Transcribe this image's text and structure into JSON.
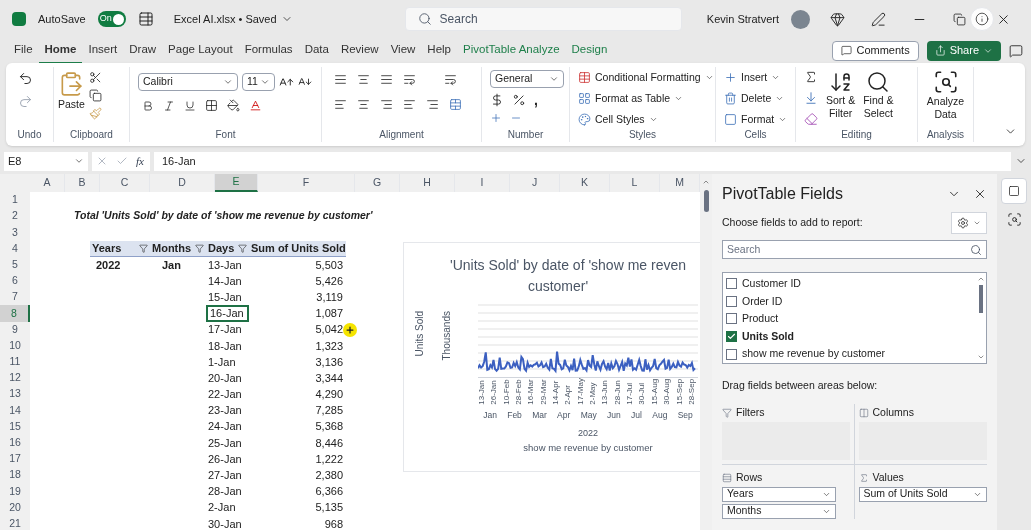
{
  "title_bar": {
    "autosave_label": "AutoSave",
    "autosave_on": true,
    "autosave_state": "On",
    "file_name": "Excel AI.xlsx • Saved",
    "search_placeholder": "Search",
    "user_name": "Kevin Stratvert"
  },
  "ribbon_tabs": [
    {
      "label": "File",
      "selected": false,
      "kind": "plain"
    },
    {
      "label": "Home",
      "selected": true,
      "kind": "plain"
    },
    {
      "label": "Insert",
      "selected": false,
      "kind": "plain"
    },
    {
      "label": "Draw",
      "selected": false,
      "kind": "plain"
    },
    {
      "label": "Page Layout",
      "selected": false,
      "kind": "plain"
    },
    {
      "label": "Formulas",
      "selected": false,
      "kind": "plain"
    },
    {
      "label": "Data",
      "selected": false,
      "kind": "plain"
    },
    {
      "label": "Review",
      "selected": false,
      "kind": "plain"
    },
    {
      "label": "View",
      "selected": false,
      "kind": "plain"
    },
    {
      "label": "Help",
      "selected": false,
      "kind": "plain"
    },
    {
      "label": "PivotTable Analyze",
      "selected": false,
      "kind": "contextual"
    },
    {
      "label": "Design",
      "selected": false,
      "kind": "contextual"
    }
  ],
  "comments_button": "Comments",
  "share_button": "Share",
  "ribbon": {
    "undo": {
      "label": "Undo"
    },
    "clipboard": {
      "label": "Clipboard",
      "paste": "Paste"
    },
    "font": {
      "label": "Font",
      "name": "Calibri",
      "size": "11"
    },
    "alignment": {
      "label": "Alignment"
    },
    "number": {
      "label": "Number",
      "format": "General",
      "comma": ","
    },
    "styles": {
      "label": "Styles",
      "items": [
        "Conditional Formatting",
        "Format as Table",
        "Cell Styles"
      ]
    },
    "cells": {
      "label": "Cells",
      "items": [
        "Insert",
        "Delete",
        "Format"
      ]
    },
    "editing": {
      "label": "Editing",
      "sort_line1": "Sort &",
      "sort_line2": "Filter",
      "find_line1": "Find &",
      "find_line2": "Select"
    },
    "analysis": {
      "label": "Analysis",
      "button_line1": "Analyze",
      "button_line2": "Data"
    }
  },
  "formula_bar": {
    "name_box": "E8",
    "fx": "fx",
    "value": "16-Jan"
  },
  "columns": [
    {
      "label": "A",
      "selected": false
    },
    {
      "label": "B",
      "selected": false
    },
    {
      "label": "C",
      "selected": false
    },
    {
      "label": "D",
      "selected": false
    },
    {
      "label": "E",
      "selected": true
    },
    {
      "label": "F",
      "selected": false
    },
    {
      "label": "G",
      "selected": false
    },
    {
      "label": "H",
      "selected": false
    },
    {
      "label": "I",
      "selected": false
    },
    {
      "label": "J",
      "selected": false
    },
    {
      "label": "K",
      "selected": false
    },
    {
      "label": "L",
      "selected": false
    },
    {
      "label": "M",
      "selected": false
    }
  ],
  "row_numbers": [
    {
      "label": "1",
      "selected": false
    },
    {
      "label": "2",
      "selected": false
    },
    {
      "label": "3",
      "selected": false
    },
    {
      "label": "4",
      "selected": false
    },
    {
      "label": "5",
      "selected": false
    },
    {
      "label": "6",
      "selected": false
    },
    {
      "label": "7",
      "selected": false
    },
    {
      "label": "8",
      "selected": true
    },
    {
      "label": "9",
      "selected": false
    },
    {
      "label": "10",
      "selected": false
    },
    {
      "label": "11",
      "selected": false
    },
    {
      "label": "12",
      "selected": false
    },
    {
      "label": "13",
      "selected": false
    },
    {
      "label": "14",
      "selected": false
    },
    {
      "label": "15",
      "selected": false
    },
    {
      "label": "16",
      "selected": false
    },
    {
      "label": "17",
      "selected": false
    },
    {
      "label": "18",
      "selected": false
    },
    {
      "label": "19",
      "selected": false
    },
    {
      "label": "20",
      "selected": false
    },
    {
      "label": "21",
      "selected": false
    }
  ],
  "sheet": {
    "title": "Total 'Units Sold' by date of 'show me revenue by customer'",
    "pivot": {
      "headers": [
        "Years",
        "Months",
        "Days",
        "Sum of Units Sold"
      ],
      "year": "2022",
      "month": "Jan",
      "rows": [
        {
          "day": "13-Jan",
          "units": "5,503",
          "selected": false
        },
        {
          "day": "14-Jan",
          "units": "5,426",
          "selected": false
        },
        {
          "day": "15-Jan",
          "units": "3,119",
          "selected": false
        },
        {
          "day": "16-Jan",
          "units": "1,087",
          "selected": true
        },
        {
          "day": "17-Jan",
          "units": "5,042",
          "selected": false
        },
        {
          "day": "18-Jan",
          "units": "1,323",
          "selected": false
        },
        {
          "day": "1-Jan",
          "units": "3,136",
          "selected": false
        },
        {
          "day": "20-Jan",
          "units": "3,344",
          "selected": false
        },
        {
          "day": "22-Jan",
          "units": "4,290",
          "selected": false
        },
        {
          "day": "23-Jan",
          "units": "7,285",
          "selected": false
        },
        {
          "day": "24-Jan",
          "units": "5,368",
          "selected": false
        },
        {
          "day": "25-Jan",
          "units": "8,446",
          "selected": false
        },
        {
          "day": "26-Jan",
          "units": "1,222",
          "selected": false
        },
        {
          "day": "27-Jan",
          "units": "2,380",
          "selected": false
        },
        {
          "day": "28-Jan",
          "units": "6,366",
          "selected": false
        },
        {
          "day": "2-Jan",
          "units": "5,135",
          "selected": false
        },
        {
          "day": "30-Jan",
          "units": "968",
          "selected": false
        }
      ]
    }
  },
  "chart": {
    "title_line1": "'Units Sold' by date of 'show me reven",
    "title_line2": "customer'",
    "y_title": "Units Sold",
    "y_unit": "Thousands",
    "date_labels": [
      "13-Jan",
      "26-Jan",
      "10-Feb",
      "28-Feb",
      "16-Mar",
      "29-Mar",
      "14-Apr",
      "2-Apr",
      "17-May",
      "2-May",
      "13-Jun",
      "28-Jun",
      "17-Jul",
      "30-Jul",
      "15-Aug",
      "30-Aug",
      "15-Sep",
      "28-Sep"
    ],
    "month_labels": [
      "Jan",
      "Feb",
      "Mar",
      "Apr",
      "May",
      "Jun",
      "Jul",
      "Aug",
      "Sep"
    ],
    "year_label": "2022",
    "x_title": "show me revenue by customer"
  },
  "pivot_pane": {
    "title": "PivotTable Fields",
    "subtitle": "Choose fields to add to report:",
    "search_placeholder": "Search",
    "fields": [
      {
        "label": "Customer ID",
        "checked": false
      },
      {
        "label": "Order ID",
        "checked": false
      },
      {
        "label": "Product",
        "checked": false
      },
      {
        "label": "Units Sold",
        "checked": true
      },
      {
        "label": "show me revenue by customer",
        "checked": false
      }
    ],
    "drag_hint": "Drag fields between areas below:",
    "areas": {
      "filters": {
        "label": "Filters"
      },
      "columns": {
        "label": "Columns"
      },
      "rows": {
        "label": "Rows",
        "items": [
          "Years",
          "Months"
        ]
      },
      "values": {
        "label": "Values",
        "items": [
          "Sum of Units Sold"
        ]
      }
    }
  }
}
